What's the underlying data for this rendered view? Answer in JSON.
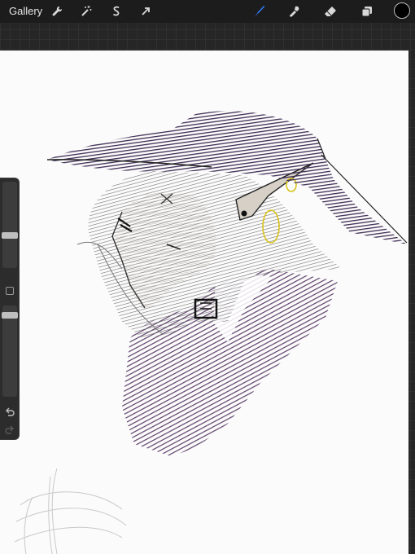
{
  "topbar": {
    "gallery_label": "Gallery",
    "left_tools": [
      {
        "name": "actions",
        "icon": "wrench-icon"
      },
      {
        "name": "adjustments",
        "icon": "magic-wand-icon"
      },
      {
        "name": "selection",
        "icon": "selection-s-icon"
      },
      {
        "name": "transform",
        "icon": "arrow-cursor-icon"
      }
    ],
    "right_tools": [
      {
        "name": "brush",
        "icon": "brush-icon",
        "active": true
      },
      {
        "name": "smudge",
        "icon": "smudge-icon"
      },
      {
        "name": "eraser",
        "icon": "eraser-icon"
      },
      {
        "name": "layers",
        "icon": "layers-icon"
      }
    ],
    "current_color": "#000000",
    "accent_color": "#2f7cf6"
  },
  "sidebar": {
    "brush_size_level": 0.65,
    "opacity_level": 0.95,
    "icons": [
      "modify-square-icon",
      "undo-icon",
      "redo-icon"
    ]
  },
  "artwork": {
    "colors": {
      "hat_purple": "#3b2a52",
      "coat_purple": "#4b2a5a",
      "hair_gray": "#555555",
      "earring_yellow": "#d8c21a"
    }
  }
}
